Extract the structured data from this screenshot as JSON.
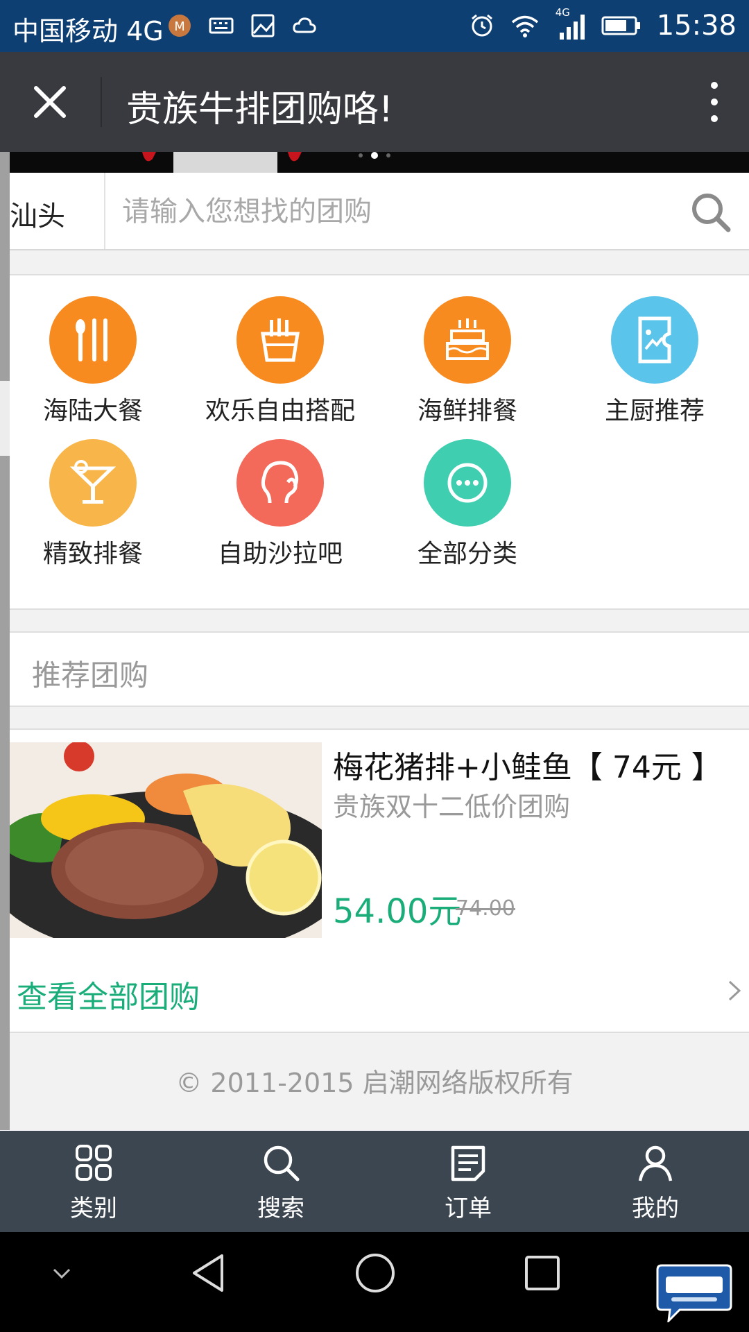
{
  "status_bar": {
    "carrier": "中国移动 4G",
    "network_label": "4G",
    "time": "15:38"
  },
  "title_bar": {
    "title": "贵族牛排团购咯!"
  },
  "search": {
    "city": "汕头",
    "placeholder": "请输入您想找的团购"
  },
  "categories": [
    {
      "label": "海陆大餐",
      "icon": "cutlery-icon",
      "color": "#f78b1f"
    },
    {
      "label": "欢乐自由搭配",
      "icon": "fries-icon",
      "color": "#f78b1f"
    },
    {
      "label": "海鲜排餐",
      "icon": "cake-icon",
      "color": "#f78b1f"
    },
    {
      "label": "主厨推荐",
      "icon": "ticket-icon",
      "color": "#5bc4ea"
    },
    {
      "label": "精致排餐",
      "icon": "cocktail-icon",
      "color": "#f7b54a"
    },
    {
      "label": "自助沙拉吧",
      "icon": "profile-icon",
      "color": "#f46a5a"
    },
    {
      "label": "全部分类",
      "icon": "more-dots-icon",
      "color": "#3fcfb0"
    }
  ],
  "recommend": {
    "heading": "推荐团购"
  },
  "deal": {
    "title": "梅花猪排+小鲑鱼【 74元 】",
    "subtitle": "贵族双十二低价团购",
    "price": "54.00元",
    "original_price": "74.00"
  },
  "view_all": {
    "label": "查看全部团购"
  },
  "footer": {
    "copyright": "© 2011-2015 启潮网络版权所有"
  },
  "tabs": [
    {
      "label": "类别",
      "icon": "grid-icon"
    },
    {
      "label": "搜索",
      "icon": "search-icon"
    },
    {
      "label": "订单",
      "icon": "order-icon"
    },
    {
      "label": "我的",
      "icon": "user-icon"
    }
  ],
  "colors": {
    "status_bar": "#0e3f73",
    "title_bar": "#393a3f",
    "accent_green": "#1aad7a",
    "tab_bar": "#3c4650"
  }
}
